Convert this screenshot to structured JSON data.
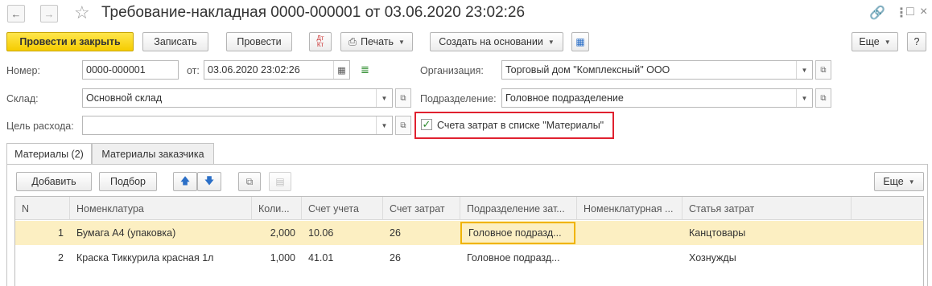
{
  "window": {
    "title": "Требование-накладная 0000-000001 от 03.06.2020 23:02:26",
    "back_icon": "arrow-left-icon",
    "forward_icon": "arrow-right-icon",
    "star_icon": "star-icon",
    "link_icon": "link-icon",
    "more_icon": "more-vertical-icon",
    "maximize_icon": "maximize-icon",
    "close_icon": "close-icon"
  },
  "toolbar": {
    "post_close": "Провести и закрыть",
    "save": "Записать",
    "post": "Провести",
    "dtkt_icon": "dt-kt-icon",
    "print": "Печать",
    "create_based": "Создать на основании",
    "structure_icon": "structure-icon",
    "more": "Еще",
    "help": "?"
  },
  "form": {
    "number_label": "Номер:",
    "number_value": "0000-000001",
    "date_label": "от:",
    "date_value": "03.06.2020 23:02:26",
    "org_label": "Организация:",
    "org_value": "Торговый дом \"Комплексный\" ООО",
    "warehouse_label": "Склад:",
    "warehouse_value": "Основной склад",
    "dept_label": "Подразделение:",
    "dept_value": "Головное подразделение",
    "purpose_label": "Цель расхода:",
    "purpose_value": "",
    "checkbox_label": "Счета затрат в списке \"Материалы\"",
    "checkbox_checked": true
  },
  "tabs": [
    {
      "label": "Материалы (2)",
      "active": true
    },
    {
      "label": "Материалы заказчика",
      "active": false
    }
  ],
  "table_toolbar": {
    "add": "Добавить",
    "pick": "Подбор",
    "more": "Еще"
  },
  "table": {
    "columns": [
      "N",
      "Номенклатура",
      "Коли...",
      "Счет учета",
      "Счет затрат",
      "Подразделение зат...",
      "Номенклатурная ...",
      "Статья затрат"
    ],
    "rows": [
      {
        "n": "1",
        "item": "Бумага А4 (упаковка)",
        "qty": "2,000",
        "account": "10.06",
        "cost_account": "26",
        "dept": "Головное подразд...",
        "nom_group": "",
        "cost_item": "Канцтовары"
      },
      {
        "n": "2",
        "item": "Краска Тиккурила красная 1л",
        "qty": "1,000",
        "account": "41.01",
        "cost_account": "26",
        "dept": "Головное подразд...",
        "nom_group": "",
        "cost_item": "Хознужды"
      }
    ]
  },
  "colors": {
    "accent_yellow": "#f5cc00",
    "highlight_red": "#e0212f",
    "selected_row": "#fcefc2"
  }
}
